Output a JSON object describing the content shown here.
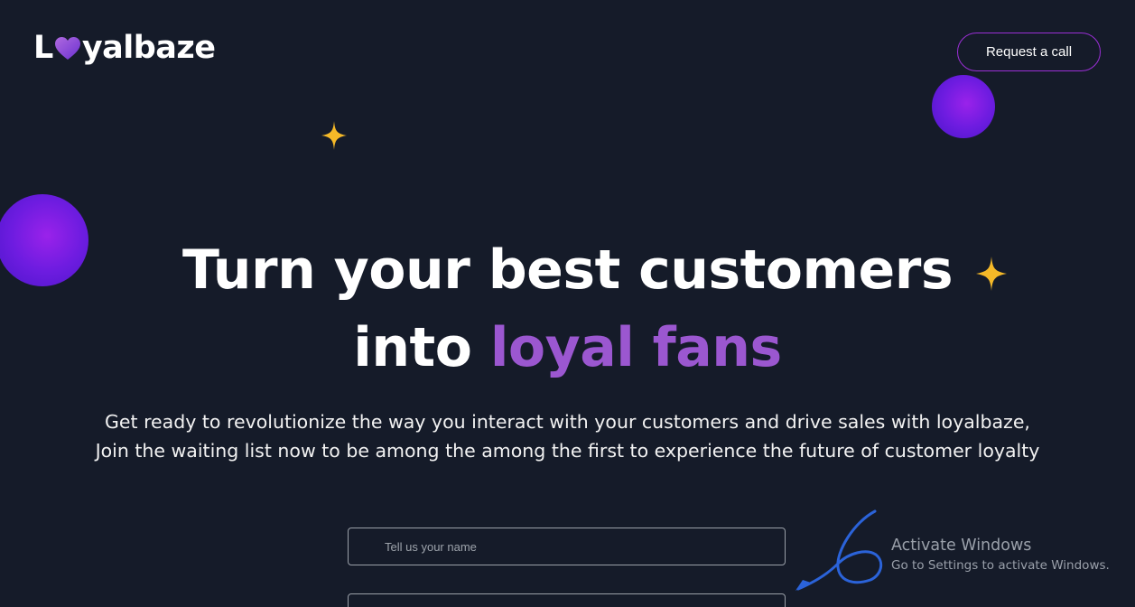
{
  "brand": {
    "logo_prefix": "L",
    "logo_suffix": "yalbaze",
    "logo_heart_icon": "heart-icon"
  },
  "header": {
    "cta_label": "Request a call",
    "cta_border_color": "#9b2fd6"
  },
  "hero": {
    "headline_line1": "Turn your best customers",
    "headline_line2_prefix": "into",
    "headline_line2_accent": "loyal fans",
    "accent_color": "#9b57d0",
    "description": "Get ready to revolutionize the way you interact with your customers and drive sales with loyalbaze, Join the waiting list now to be among the among the first to experience the future of customer loyalty"
  },
  "form": {
    "name_placeholder": "Tell us your name",
    "name_value": "",
    "email_placeholder": "",
    "email_value": ""
  },
  "decorations": {
    "sparkle_color": "#f5b928",
    "orb_color": "#7a1fe4",
    "arrow_color": "#2b63d9"
  },
  "os_watermark": {
    "title": "Activate Windows",
    "subtitle": "Go to Settings to activate Windows."
  },
  "colors": {
    "background": "#151b29",
    "text": "#ffffff"
  }
}
